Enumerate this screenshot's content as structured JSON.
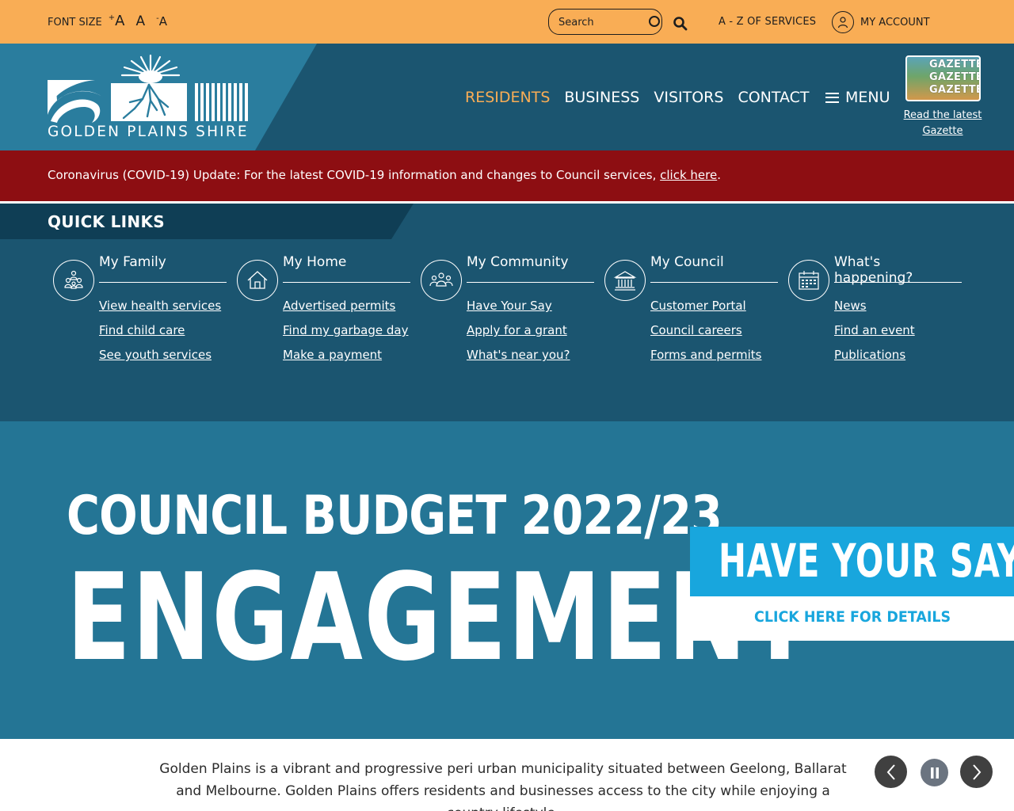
{
  "utility": {
    "font_size_label": "FONT SIZE",
    "font_increase": "A",
    "font_normal": "A",
    "font_decrease": "A",
    "search_placeholder": "Search",
    "az_label": "A - Z OF SERVICES",
    "account_label": "MY ACCOUNT"
  },
  "header": {
    "logo_text": "GOLDEN PLAINS SHIRE",
    "nav": [
      {
        "label": "RESIDENTS",
        "active": true
      },
      {
        "label": "BUSINESS"
      },
      {
        "label": "VISITORS"
      },
      {
        "label": "CONTACT"
      }
    ],
    "menu_label": "MENU",
    "gazette_image_text": "GAZETTE",
    "gazette_link": "Read the latest Gazette"
  },
  "alert": {
    "text": "Coronavirus (COVID-19) Update: For the latest COVID-19 information and changes to Council services, ",
    "link": "click here",
    "end": "."
  },
  "quick_links": {
    "title": "QUICK LINKS",
    "columns": [
      {
        "icon": "family-icon",
        "heading": "My Family",
        "links": [
          "View health services",
          "Find child care",
          "See youth services"
        ]
      },
      {
        "icon": "home-icon",
        "heading": "My Home",
        "links": [
          "Advertised permits",
          "Find my garbage day",
          "Make a payment"
        ]
      },
      {
        "icon": "community-icon",
        "heading": "My Community",
        "links": [
          "Have Your Say",
          "Apply for a grant",
          "What's near you?"
        ]
      },
      {
        "icon": "council-building-icon",
        "heading": "My Council",
        "links": [
          "Customer Portal",
          "Council careers",
          "Forms and permits"
        ]
      },
      {
        "icon": "calendar-icon",
        "heading": "What's happening?",
        "links": [
          "News",
          "Find an event",
          "Publications"
        ]
      }
    ]
  },
  "hero": {
    "line1": "COUNCIL BUDGET 2022/23",
    "line2": "ENGAGEMENT",
    "badge": "HAVE YOUR SAY",
    "cta": "CLICK HERE FOR DETAILS"
  },
  "intro": {
    "text": "Golden Plains is a vibrant and progressive peri urban municipality situated between Geelong, Ballarat and Melbourne. Golden Plains offers residents and businesses access to the city while enjoying a country lifestyle."
  },
  "colors": {
    "utility_bg": "#f9ad55",
    "header_bg": "#1b5570",
    "logo_panel": "#2a7d9e",
    "alert_bg": "#8d0e12",
    "active_nav": "#f9ad55",
    "hero_bg": "#247595",
    "badge_bg": "#18a6dd"
  }
}
